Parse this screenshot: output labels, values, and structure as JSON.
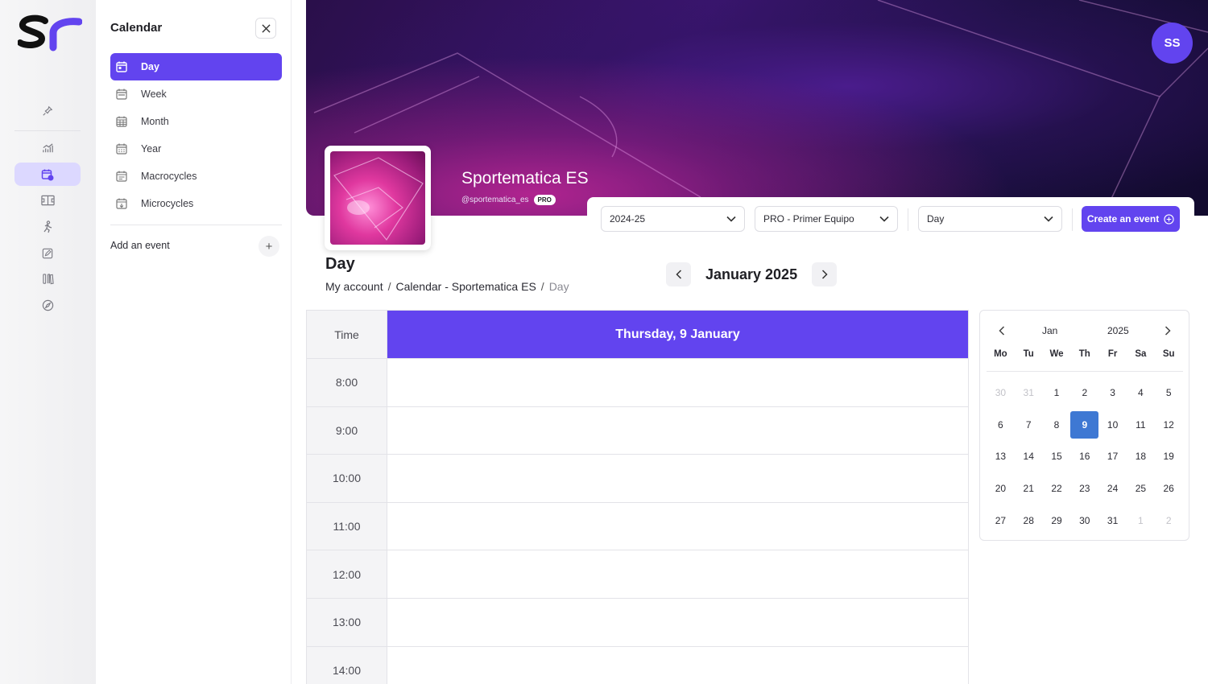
{
  "panel": {
    "title": "Calendar",
    "menu": [
      {
        "label": "Day",
        "icon": "calendar-day-icon",
        "active": true
      },
      {
        "label": "Week",
        "icon": "calendar-week-icon"
      },
      {
        "label": "Month",
        "icon": "calendar-month-icon"
      },
      {
        "label": "Year",
        "icon": "calendar-year-icon"
      },
      {
        "label": "Macrocycles",
        "icon": "calendar-macro-icon"
      },
      {
        "label": "Microcycles",
        "icon": "calendar-micro-icon"
      }
    ],
    "add_event_label": "Add an event",
    "add_event_symbol": "+"
  },
  "user": {
    "initials": "SS"
  },
  "team": {
    "name": "Sportematica ES",
    "handle": "@sportematica_es",
    "badge": "PRO"
  },
  "filters": {
    "season": "2024-25",
    "team": "PRO - Primer Equipo",
    "view": "Day",
    "create_label": "Create an event"
  },
  "page": {
    "title": "Day",
    "breadcrumb": [
      "My account",
      "Calendar - Sportematica ES",
      "Day"
    ],
    "breadcrumb_sep": "/"
  },
  "month_nav": {
    "label": "January 2025"
  },
  "day_grid": {
    "time_header": "Time",
    "day_header": "Thursday, 9 January",
    "times": [
      "8:00",
      "9:00",
      "10:00",
      "11:00",
      "12:00",
      "13:00",
      "14:00"
    ]
  },
  "mini_calendar": {
    "month": "Jan",
    "year": "2025",
    "dow": [
      "Mo",
      "Tu",
      "We",
      "Th",
      "Fr",
      "Sa",
      "Su"
    ],
    "weeks": [
      [
        {
          "d": "30",
          "m": true
        },
        {
          "d": "31",
          "m": true
        },
        {
          "d": "1"
        },
        {
          "d": "2"
        },
        {
          "d": "3"
        },
        {
          "d": "4"
        },
        {
          "d": "5"
        }
      ],
      [
        {
          "d": "6"
        },
        {
          "d": "7"
        },
        {
          "d": "8"
        },
        {
          "d": "9",
          "s": true
        },
        {
          "d": "10"
        },
        {
          "d": "11"
        },
        {
          "d": "12"
        }
      ],
      [
        {
          "d": "13"
        },
        {
          "d": "14"
        },
        {
          "d": "15"
        },
        {
          "d": "16"
        },
        {
          "d": "17"
        },
        {
          "d": "18"
        },
        {
          "d": "19"
        }
      ],
      [
        {
          "d": "20"
        },
        {
          "d": "21"
        },
        {
          "d": "22"
        },
        {
          "d": "23"
        },
        {
          "d": "24"
        },
        {
          "d": "25"
        },
        {
          "d": "26"
        }
      ],
      [
        {
          "d": "27"
        },
        {
          "d": "28"
        },
        {
          "d": "29"
        },
        {
          "d": "30"
        },
        {
          "d": "31"
        },
        {
          "d": "1",
          "m": true
        },
        {
          "d": "2",
          "m": true
        }
      ]
    ]
  },
  "colors": {
    "accent": "#6244ef",
    "selected_day": "#3e78d3"
  }
}
